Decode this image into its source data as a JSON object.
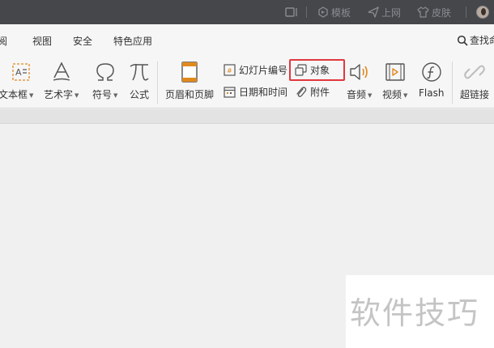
{
  "titlebar": {
    "template_label": "模板",
    "upload_label": "上网",
    "skin_label": "皮肤"
  },
  "menu": {
    "items": [
      "阅",
      "视图",
      "安全",
      "特色应用"
    ],
    "find_label": "查找命"
  },
  "ribbon": {
    "textbox": "文本框",
    "wordart": "艺术字",
    "symbol": "符号",
    "formula": "公式",
    "header_footer": "页眉和页脚",
    "slide_number": "幻灯片编号",
    "object": "对象",
    "date_time": "日期和时间",
    "attachment": "附件",
    "audio": "音频",
    "video": "视频",
    "flash": "Flash",
    "hyperlink": "超链接"
  },
  "watermark": "软件技巧",
  "colors": {
    "titlebar": "#46474b",
    "highlight": "#e0383e",
    "icon_orange": "#e08a1e",
    "icon_gray": "#555555"
  }
}
